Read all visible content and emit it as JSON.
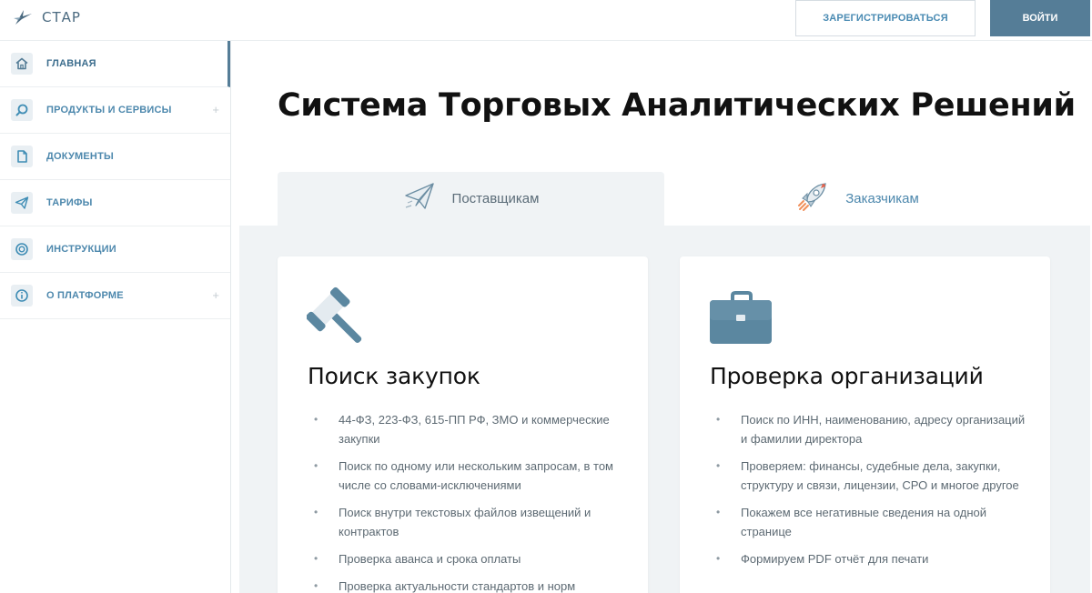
{
  "brand": {
    "name": "СТАР"
  },
  "header": {
    "register_label": "ЗАРЕГИСТРИРОВАТЬСЯ",
    "login_label": "ВОЙТИ"
  },
  "sidebar": {
    "items": [
      {
        "label": "ГЛАВНАЯ",
        "icon": "home-icon",
        "active": true
      },
      {
        "label": "ПРОДУКТЫ И СЕРВИСЫ",
        "icon": "search-icon",
        "expandable": true,
        "plus": "+"
      },
      {
        "label": "ДОКУМЕНТЫ",
        "icon": "document-icon"
      },
      {
        "label": "ТАРИФЫ",
        "icon": "paper-plane-icon"
      },
      {
        "label": "ИНСТРУКЦИИ",
        "icon": "lifebuoy-icon"
      },
      {
        "label": "О ПЛАТФОРМЕ",
        "icon": "info-icon",
        "expandable": true,
        "plus": "+"
      }
    ]
  },
  "main": {
    "title": "Система Торговых Аналитических Решений",
    "tabs": [
      {
        "label": "Поставщикам",
        "icon": "paper-plane-icon",
        "active": true
      },
      {
        "label": "Заказчикам",
        "icon": "rocket-icon",
        "active": false
      }
    ],
    "cards": [
      {
        "title": "Поиск закупок",
        "icon": "gavel-icon",
        "items": [
          "44-ФЗ, 223-ФЗ, 615-ПП РФ, ЗМО и коммерческие закупки",
          "Поиск по одному или нескольким запросам, в том числе со словами-исключениями",
          "Поиск внутри текстовых файлов извещений и контрактов",
          "Проверка аванса и срока оплаты",
          "Проверка актуальности стандартов и норм"
        ]
      },
      {
        "title": "Проверка организаций",
        "icon": "briefcase-icon",
        "items": [
          "Поиск по ИНН, наименованию, адресу организаций и фамилии директора",
          "Проверяем: финансы, судебные дела, закупки, структуру и связи, лицензии, СРО и многое другое",
          "Покажем все негативные сведения на одной странице",
          "Формируем PDF отчёт для печати"
        ]
      }
    ]
  },
  "colors": {
    "accent": "#557d97",
    "link": "#4d88ad",
    "panel_bg": "#f0f3f5",
    "icon_steel": "#5b87a0"
  }
}
